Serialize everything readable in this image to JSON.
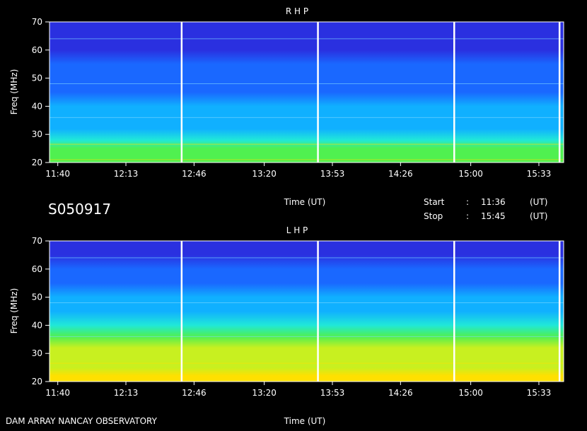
{
  "labels": {
    "date_code": "S050917",
    "footer": "DAM ARRAY  NANCAY OBSERVATORY",
    "start_label": "Start",
    "stop_label": "Stop",
    "colon": ":",
    "start_time": "11:36",
    "stop_time": "15:45",
    "ut_label": "(UT)"
  },
  "colors": {
    "background": "#000000",
    "text": "#ffffff",
    "colormap": [
      "#3a10a0",
      "#2a30e0",
      "#1a68ff",
      "#10b0ff",
      "#20e8d8",
      "#50f050",
      "#c8f020",
      "#ffe000",
      "#ff6000",
      "#d00000"
    ]
  },
  "chart_data": [
    {
      "type": "heatmap",
      "title": "R H P",
      "xlabel": "Time (UT)",
      "ylabel": "Freq (MHz)",
      "x_range": [
        "11:36",
        "15:45"
      ],
      "ylim": [
        20,
        70
      ],
      "x_ticks": [
        "11:40",
        "12:13",
        "12:46",
        "13:20",
        "13:53",
        "14:26",
        "15:00",
        "15:33"
      ],
      "y_ticks": [
        "20",
        "30",
        "40",
        "50",
        "60",
        "70"
      ],
      "data_gaps_ut": [
        "12:40",
        "13:46",
        "14:52",
        "15:43"
      ],
      "intensity_profile": {
        "freq_mhz": [
          20,
          22,
          25,
          28,
          32,
          36,
          40,
          45,
          50,
          55,
          60,
          65,
          70
        ],
        "level": [
          0.55,
          0.55,
          0.5,
          0.45,
          0.38,
          0.36,
          0.3,
          0.26,
          0.22,
          0.18,
          0.15,
          0.12,
          0.1
        ]
      },
      "interference_lines_mhz": [
        21.0,
        26.5,
        36.0,
        48.0,
        64.0
      ]
    },
    {
      "type": "heatmap",
      "title": "L H P",
      "xlabel": "Time (UT)",
      "ylabel": "Freq (MHz)",
      "x_range": [
        "11:36",
        "15:45"
      ],
      "ylim": [
        20,
        70
      ],
      "x_ticks": [
        "11:40",
        "12:13",
        "12:46",
        "13:20",
        "13:53",
        "14:26",
        "15:00",
        "15:33"
      ],
      "y_ticks": [
        "20",
        "30",
        "40",
        "50",
        "60",
        "70"
      ],
      "data_gaps_ut": [
        "12:40",
        "13:46",
        "14:52",
        "15:43"
      ],
      "intensity_profile": {
        "freq_mhz": [
          20,
          22,
          25,
          28,
          32,
          36,
          40,
          45,
          50,
          55,
          60,
          65,
          70
        ],
        "level": [
          0.75,
          0.75,
          0.72,
          0.7,
          0.62,
          0.52,
          0.42,
          0.35,
          0.28,
          0.24,
          0.2,
          0.16,
          0.14
        ]
      },
      "interference_lines_mhz": [
        21.0,
        26.5,
        36.0,
        48.0,
        64.0
      ]
    }
  ]
}
